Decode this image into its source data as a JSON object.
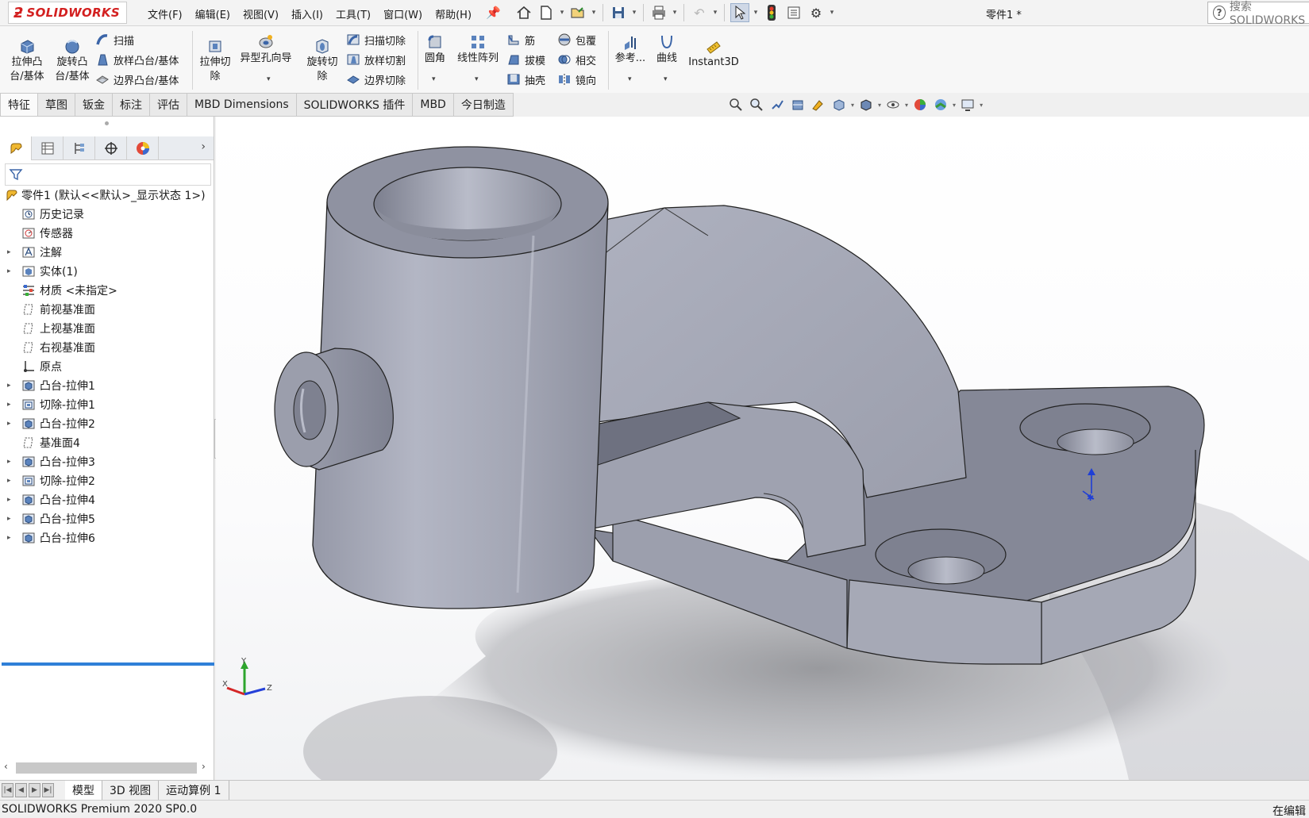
{
  "app": {
    "logo_text": "SOLIDWORKS",
    "document_title": "零件1 *",
    "search_placeholder": "搜索 SOLIDWORKS"
  },
  "menus": [
    "文件(F)",
    "编辑(E)",
    "视图(V)",
    "插入(I)",
    "工具(T)",
    "窗口(W)",
    "帮助(H)"
  ],
  "ribbon": {
    "extrude_boss": "拉伸凸台/基体",
    "revolve_boss": "旋转凸台/基体",
    "sweep": "扫描",
    "loft_boss": "放样凸台/基体",
    "boundary_boss": "边界凸台/基体",
    "extrude_cut": "拉伸切除",
    "hole_wizard": "异型孔向导",
    "revolve_cut": "旋转切除",
    "swept_cut": "扫描切除",
    "lofted_cut": "放样切割",
    "boundary_cut": "边界切除",
    "fillet": "圆角",
    "linear_pattern": "线性阵列",
    "rib": "筋",
    "draft": "拔模",
    "shell": "抽壳",
    "wrap": "包覆",
    "intersect": "相交",
    "mirror": "镜向",
    "reference": "参考...",
    "curves": "曲线",
    "instant3d": "Instant3D"
  },
  "tabs": [
    "特征",
    "草图",
    "钣金",
    "标注",
    "评估",
    "MBD Dimensions",
    "SOLIDWORKS 插件",
    "MBD",
    "今日制造"
  ],
  "tree": {
    "root": "零件1  (默认<<默认>_显示状态 1>)",
    "items": [
      {
        "label": "历史记录",
        "icon": "history-icon",
        "expand": false
      },
      {
        "label": "传感器",
        "icon": "sensor-icon",
        "expand": false
      },
      {
        "label": "注解",
        "icon": "annotation-icon",
        "expand": true
      },
      {
        "label": "实体(1)",
        "icon": "solid-body-icon",
        "expand": true
      },
      {
        "label": "材质 <未指定>",
        "icon": "material-icon",
        "expand": false
      },
      {
        "label": "前视基准面",
        "icon": "plane-icon",
        "expand": false
      },
      {
        "label": "上视基准面",
        "icon": "plane-icon",
        "expand": false
      },
      {
        "label": "右视基准面",
        "icon": "plane-icon",
        "expand": false
      },
      {
        "label": "原点",
        "icon": "origin-icon",
        "expand": false
      },
      {
        "label": "凸台-拉伸1",
        "icon": "boss-extrude-icon",
        "expand": true
      },
      {
        "label": "切除-拉伸1",
        "icon": "cut-extrude-icon",
        "expand": true
      },
      {
        "label": "凸台-拉伸2",
        "icon": "boss-extrude-icon",
        "expand": true
      },
      {
        "label": "基准面4",
        "icon": "plane-icon",
        "expand": false
      },
      {
        "label": "凸台-拉伸3",
        "icon": "boss-extrude-icon",
        "expand": true
      },
      {
        "label": "切除-拉伸2",
        "icon": "cut-extrude-icon",
        "expand": true
      },
      {
        "label": "凸台-拉伸4",
        "icon": "boss-extrude-icon",
        "expand": true
      },
      {
        "label": "凸台-拉伸5",
        "icon": "boss-extrude-icon",
        "expand": true
      },
      {
        "label": "凸台-拉伸6",
        "icon": "boss-extrude-icon",
        "expand": true
      }
    ]
  },
  "triad": {
    "x": "X",
    "y": "Y",
    "z": "Z"
  },
  "bottom_tabs": [
    "模型",
    "3D 视图",
    "运动算例 1"
  ],
  "status": {
    "left": "SOLIDWORKS Premium 2020 SP0.0",
    "right": "在编辑"
  },
  "colors": {
    "brand_red": "#d32020",
    "part_face": "#a8abb9",
    "rollback_bar": "#2f7fd8"
  }
}
